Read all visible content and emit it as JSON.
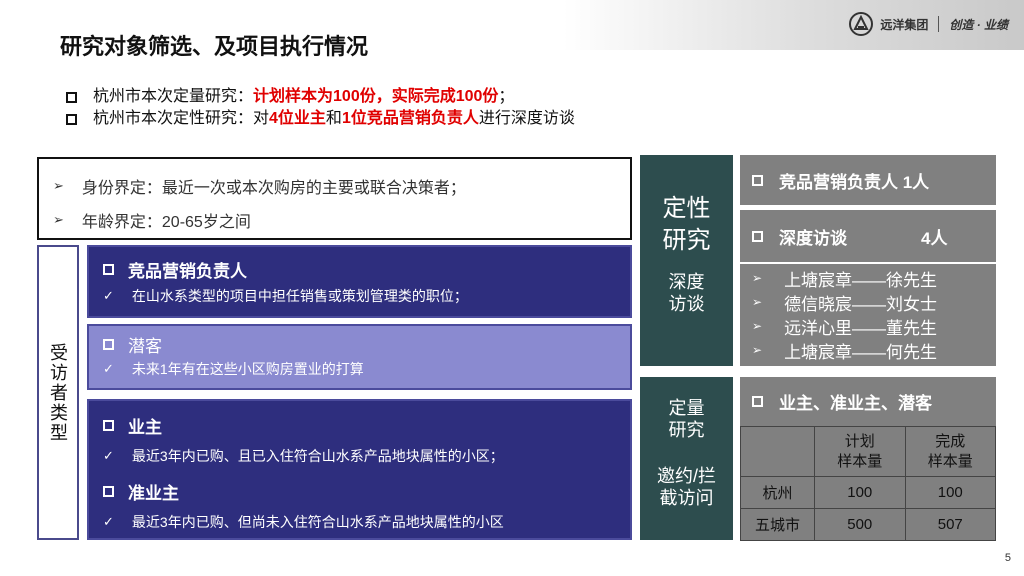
{
  "brand": {
    "name": "远洋集团",
    "slogan": "创造 · 业绩"
  },
  "title": "研究对象筛选、及项目执行情况",
  "bullets": [
    {
      "prefix": "杭州市本次定量研究：",
      "highlight": "计划样本为100份，实际完成100份",
      "suffix": "；"
    },
    {
      "prefix": "杭州市本次定性研究：对",
      "h1": "4位业主",
      "mid": "和",
      "h2": "1位竞品营销负责人",
      "suffix": "进行深度访谈"
    }
  ],
  "definitions": [
    "身份界定：最近一次或本次购房的主要或联合决策者；",
    "年龄界定：20-65岁之间"
  ],
  "side_label": "受访者类型",
  "respondents": {
    "box1": {
      "heading": "竞品营销负责人",
      "detail": "在山水系类型的项目中担任销售或策划管理类的职位；"
    },
    "box2": {
      "heading": "潜客",
      "detail": "未来1年有在这些小区购房置业的打算"
    },
    "box3": {
      "heading1": "业主",
      "detail1": "最近3年内已购、且已入住符合山水系产品地块属性的小区；",
      "heading2": "准业主",
      "detail2": "最近3年内已购、但尚未入住符合山水系产品地块属性的小区"
    }
  },
  "qualitative": {
    "title1": "定性",
    "title2": "研究",
    "sub1": "深度",
    "sub2": "访谈"
  },
  "quantitative": {
    "title1": "定量",
    "title2": "研究",
    "sub1": "邀约/拦",
    "sub2": "截访问"
  },
  "qual_right": {
    "marketing": "竞品营销负责人  1人",
    "interview": "深度访谈",
    "interview_count": "4人",
    "names": [
      "上塘宸章——徐先生",
      "德信晓宸——刘女士",
      "远洋心里——董先生",
      "上塘宸章——何先生"
    ]
  },
  "quant_right": {
    "heading": "业主、准业主、潜客",
    "table": {
      "header": [
        "",
        "计划\n样本量",
        "完成\n样本量"
      ],
      "rows": [
        [
          "杭州",
          "100",
          "100"
        ],
        [
          "五城市",
          "500",
          "507"
        ]
      ]
    }
  },
  "page_number": "5"
}
